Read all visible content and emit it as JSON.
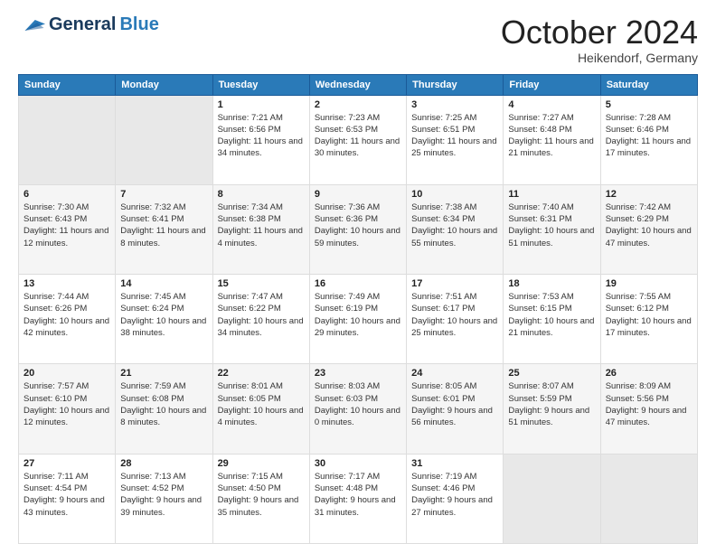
{
  "header": {
    "logo_general": "General",
    "logo_blue": "Blue",
    "month_title": "October 2024",
    "location": "Heikendorf, Germany"
  },
  "weekdays": [
    "Sunday",
    "Monday",
    "Tuesday",
    "Wednesday",
    "Thursday",
    "Friday",
    "Saturday"
  ],
  "weeks": [
    [
      null,
      null,
      {
        "day": 1,
        "sunrise": "7:21 AM",
        "sunset": "6:56 PM",
        "daylight": "11 hours and 34 minutes."
      },
      {
        "day": 2,
        "sunrise": "7:23 AM",
        "sunset": "6:53 PM",
        "daylight": "11 hours and 30 minutes."
      },
      {
        "day": 3,
        "sunrise": "7:25 AM",
        "sunset": "6:51 PM",
        "daylight": "11 hours and 25 minutes."
      },
      {
        "day": 4,
        "sunrise": "7:27 AM",
        "sunset": "6:48 PM",
        "daylight": "11 hours and 21 minutes."
      },
      {
        "day": 5,
        "sunrise": "7:28 AM",
        "sunset": "6:46 PM",
        "daylight": "11 hours and 17 minutes."
      }
    ],
    [
      {
        "day": 6,
        "sunrise": "7:30 AM",
        "sunset": "6:43 PM",
        "daylight": "11 hours and 12 minutes."
      },
      {
        "day": 7,
        "sunrise": "7:32 AM",
        "sunset": "6:41 PM",
        "daylight": "11 hours and 8 minutes."
      },
      {
        "day": 8,
        "sunrise": "7:34 AM",
        "sunset": "6:38 PM",
        "daylight": "11 hours and 4 minutes."
      },
      {
        "day": 9,
        "sunrise": "7:36 AM",
        "sunset": "6:36 PM",
        "daylight": "10 hours and 59 minutes."
      },
      {
        "day": 10,
        "sunrise": "7:38 AM",
        "sunset": "6:34 PM",
        "daylight": "10 hours and 55 minutes."
      },
      {
        "day": 11,
        "sunrise": "7:40 AM",
        "sunset": "6:31 PM",
        "daylight": "10 hours and 51 minutes."
      },
      {
        "day": 12,
        "sunrise": "7:42 AM",
        "sunset": "6:29 PM",
        "daylight": "10 hours and 47 minutes."
      }
    ],
    [
      {
        "day": 13,
        "sunrise": "7:44 AM",
        "sunset": "6:26 PM",
        "daylight": "10 hours and 42 minutes."
      },
      {
        "day": 14,
        "sunrise": "7:45 AM",
        "sunset": "6:24 PM",
        "daylight": "10 hours and 38 minutes."
      },
      {
        "day": 15,
        "sunrise": "7:47 AM",
        "sunset": "6:22 PM",
        "daylight": "10 hours and 34 minutes."
      },
      {
        "day": 16,
        "sunrise": "7:49 AM",
        "sunset": "6:19 PM",
        "daylight": "10 hours and 29 minutes."
      },
      {
        "day": 17,
        "sunrise": "7:51 AM",
        "sunset": "6:17 PM",
        "daylight": "10 hours and 25 minutes."
      },
      {
        "day": 18,
        "sunrise": "7:53 AM",
        "sunset": "6:15 PM",
        "daylight": "10 hours and 21 minutes."
      },
      {
        "day": 19,
        "sunrise": "7:55 AM",
        "sunset": "6:12 PM",
        "daylight": "10 hours and 17 minutes."
      }
    ],
    [
      {
        "day": 20,
        "sunrise": "7:57 AM",
        "sunset": "6:10 PM",
        "daylight": "10 hours and 12 minutes."
      },
      {
        "day": 21,
        "sunrise": "7:59 AM",
        "sunset": "6:08 PM",
        "daylight": "10 hours and 8 minutes."
      },
      {
        "day": 22,
        "sunrise": "8:01 AM",
        "sunset": "6:05 PM",
        "daylight": "10 hours and 4 minutes."
      },
      {
        "day": 23,
        "sunrise": "8:03 AM",
        "sunset": "6:03 PM",
        "daylight": "10 hours and 0 minutes."
      },
      {
        "day": 24,
        "sunrise": "8:05 AM",
        "sunset": "6:01 PM",
        "daylight": "9 hours and 56 minutes."
      },
      {
        "day": 25,
        "sunrise": "8:07 AM",
        "sunset": "5:59 PM",
        "daylight": "9 hours and 51 minutes."
      },
      {
        "day": 26,
        "sunrise": "8:09 AM",
        "sunset": "5:56 PM",
        "daylight": "9 hours and 47 minutes."
      }
    ],
    [
      {
        "day": 27,
        "sunrise": "7:11 AM",
        "sunset": "4:54 PM",
        "daylight": "9 hours and 43 minutes."
      },
      {
        "day": 28,
        "sunrise": "7:13 AM",
        "sunset": "4:52 PM",
        "daylight": "9 hours and 39 minutes."
      },
      {
        "day": 29,
        "sunrise": "7:15 AM",
        "sunset": "4:50 PM",
        "daylight": "9 hours and 35 minutes."
      },
      {
        "day": 30,
        "sunrise": "7:17 AM",
        "sunset": "4:48 PM",
        "daylight": "9 hours and 31 minutes."
      },
      {
        "day": 31,
        "sunrise": "7:19 AM",
        "sunset": "4:46 PM",
        "daylight": "9 hours and 27 minutes."
      },
      null,
      null
    ]
  ]
}
